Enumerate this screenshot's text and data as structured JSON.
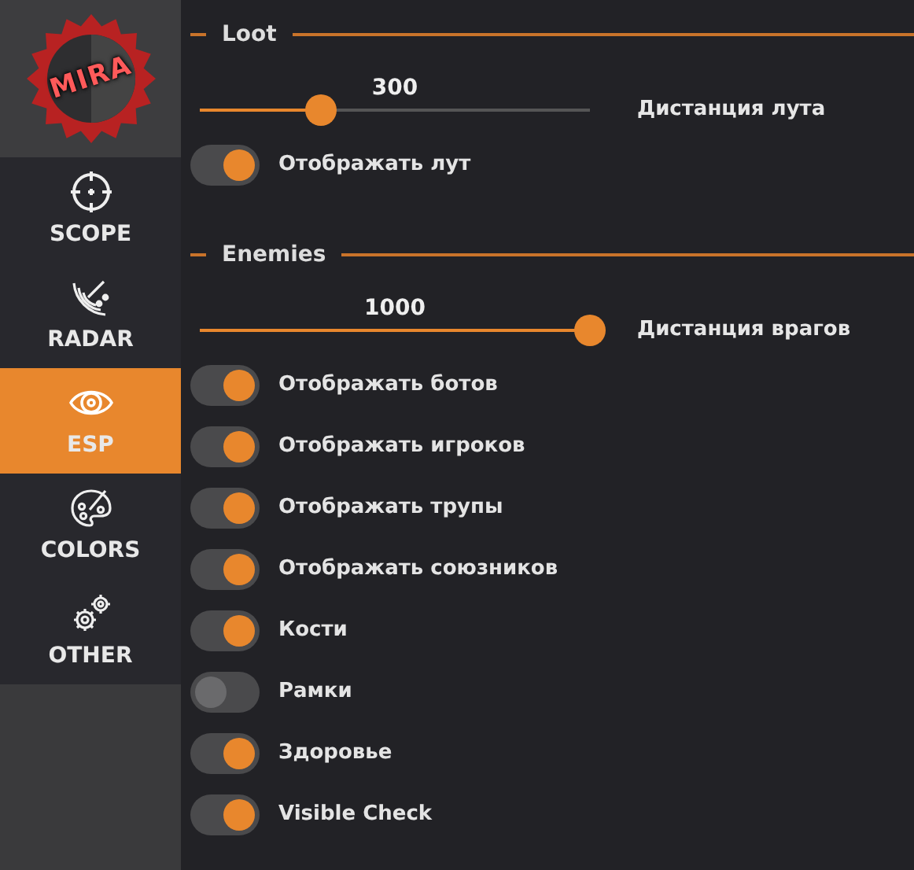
{
  "logo": {
    "text": "MIRA"
  },
  "sidebar": {
    "items": [
      {
        "label": "SCOPE",
        "kind": "scope",
        "selected": false
      },
      {
        "label": "RADAR",
        "kind": "radar",
        "selected": false
      },
      {
        "label": "ESP",
        "kind": "eye",
        "selected": true
      },
      {
        "label": "COLORS",
        "kind": "palette",
        "selected": false
      },
      {
        "label": "OTHER",
        "kind": "gears",
        "selected": false
      }
    ]
  },
  "sections": [
    {
      "title": "Loot",
      "sliders": [
        {
          "value": "300",
          "level": 0.31,
          "label": "Дистанция лута"
        }
      ],
      "toggles": [
        {
          "label": "Отображать лут",
          "on": true
        }
      ]
    },
    {
      "title": "Enemies",
      "sliders": [
        {
          "value": "1000",
          "level": 1.0,
          "label": "Дистанция врагов"
        }
      ],
      "toggles": [
        {
          "label": "Отображать ботов",
          "on": true
        },
        {
          "label": "Отображать игроков",
          "on": true
        },
        {
          "label": "Отображать трупы",
          "on": true
        },
        {
          "label": "Отображать союзников",
          "on": true
        },
        {
          "label": "Кости",
          "on": true
        },
        {
          "label": "Рамки",
          "on": false
        },
        {
          "label": "Здоровье",
          "on": true
        },
        {
          "label": "Visible Check",
          "on": true
        }
      ]
    }
  ]
}
